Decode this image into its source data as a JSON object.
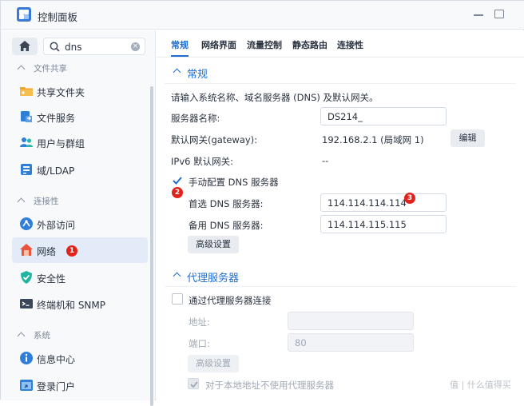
{
  "window": {
    "title": "控制面板"
  },
  "sidebar": {
    "search": {
      "value": "dns",
      "placeholder": ""
    },
    "sections": [
      {
        "label": "文件共享",
        "items": [
          {
            "label": "共享文件夹",
            "icon": "shared-folder-icon"
          },
          {
            "label": "文件服务",
            "icon": "file-services-icon"
          },
          {
            "label": "用户与群组",
            "icon": "users-groups-icon"
          },
          {
            "label": "域/LDAP",
            "icon": "domain-ldap-icon"
          }
        ]
      },
      {
        "label": "连接性",
        "items": [
          {
            "label": "外部访问",
            "icon": "external-access-icon"
          },
          {
            "label": "网络",
            "icon": "network-house-icon",
            "active": true,
            "badge": "1"
          },
          {
            "label": "安全性",
            "icon": "security-shield-icon"
          },
          {
            "label": "终端机和 SNMP",
            "icon": "terminal-icon"
          }
        ]
      },
      {
        "label": "系统",
        "items": [
          {
            "label": "信息中心",
            "icon": "info-center-icon"
          },
          {
            "label": "登录门户",
            "icon": "login-portal-icon"
          }
        ]
      }
    ]
  },
  "tabs": [
    "常规",
    "网络界面",
    "流量控制",
    "静态路由",
    "连接性"
  ],
  "general": {
    "title": "常规",
    "description": "请输入系统名称、域名服务器 (DNS) 及默认网关。",
    "server_name_label": "服务器名称:",
    "server_name_value": "DS214_",
    "gateway_label": "默认网关(gateway):",
    "gateway_value": "192.168.2.1 (局域网 1)",
    "edit_button": "编辑",
    "ipv6_label": "IPv6 默认网关:",
    "ipv6_value": "--",
    "manual_dns_label": "手动配置 DNS 服务器",
    "manual_dns_checked": true,
    "manual_dns_badge": "2",
    "preferred_dns_label": "首选 DNS 服务器:",
    "preferred_dns_value": "114.114.114.114",
    "preferred_dns_badge": "3",
    "alternate_dns_label": "备用 DNS 服务器:",
    "alternate_dns_value": "114.114.115.115",
    "advanced_button": "高级设置"
  },
  "proxy": {
    "title": "代理服务器",
    "connect_label": "通过代理服务器连接",
    "connect_checked": false,
    "address_label": "地址:",
    "address_value": "",
    "port_label": "端口:",
    "port_value": "80",
    "advanced_button": "高级设置",
    "bypass_label": "对于本地地址不使用代理服务器",
    "bypass_checked": true
  },
  "watermark": "值 | 什么值得买",
  "colors": {
    "accent": "#1e6fd0",
    "badge": "#e2231a",
    "active_item_bg": "#e2ebf7"
  }
}
